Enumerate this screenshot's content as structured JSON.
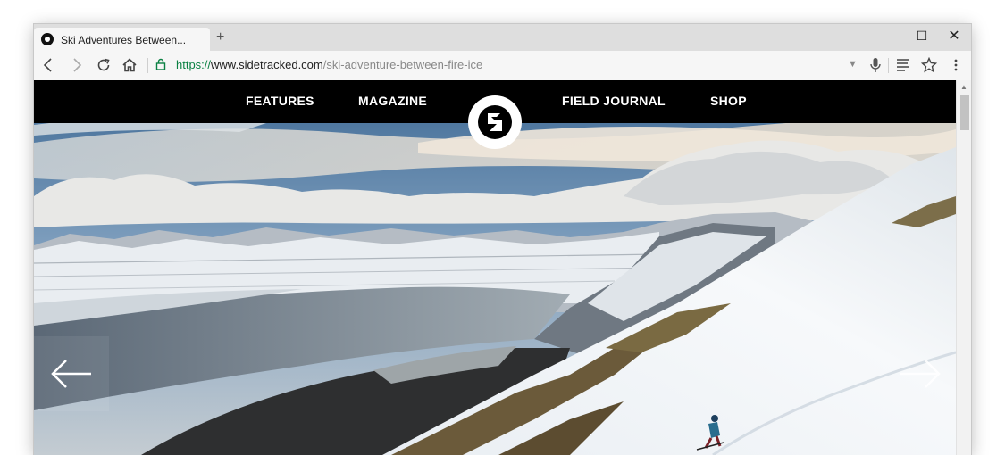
{
  "tab": {
    "title": "Ski Adventures Between...",
    "new_tab_glyph": "+"
  },
  "window_controls": {
    "minimize": "—",
    "maximize": "☐",
    "close": "✕"
  },
  "address_bar": {
    "scheme": "https://",
    "domain": "www.sidetracked.com",
    "path": "/ski-adventure-between-fire-ice"
  },
  "site_nav": {
    "items": [
      {
        "label": "FEATURES"
      },
      {
        "label": "MAGAZINE"
      },
      {
        "label": "FIELD JOURNAL"
      },
      {
        "label": "SHOP"
      }
    ]
  },
  "icons": {
    "back": "arrow-left-icon",
    "forward": "arrow-right-icon",
    "reload": "reload-icon",
    "home": "home-icon",
    "lock": "lock-icon",
    "mic": "microphone-icon",
    "reader": "reader-mode-icon",
    "star": "star-icon",
    "menu": "kebab-menu-icon",
    "logo": "sidetracked-logo",
    "prev": "arrow-left-icon",
    "next": "arrow-right-icon"
  },
  "colors": {
    "secure": "#0b8043",
    "nav_bg": "#000000",
    "nav_text": "#ffffff"
  }
}
